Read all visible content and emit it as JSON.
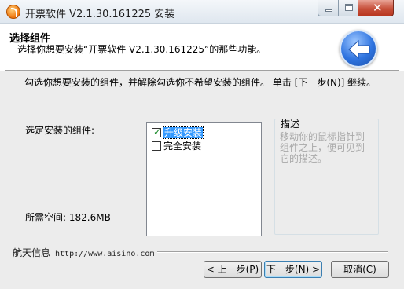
{
  "window": {
    "title": "开票软件 V2.1.30.161225 安装"
  },
  "header": {
    "title": "选择组件",
    "subtitle": "选择你想要安装“开票软件 V2.1.30.161225”的那些功能。"
  },
  "body": {
    "instruction": "勾选你想要安装的组件，并解除勾选你不希望安装的组件。 单击 [下一步(N)] 继续。",
    "select_label": "选定安装的组件:",
    "space_label": "所需空间: 182.6MB",
    "components": [
      {
        "label": "升级安装",
        "checked": true,
        "selected": true
      },
      {
        "label": "完全安装",
        "checked": false,
        "selected": false
      }
    ],
    "description": {
      "title": "描述",
      "text": "移动你的鼠标指针到组件之上，便可见到它的描述。"
    }
  },
  "footer": {
    "brand": "航天信息",
    "url": "http://www.aisino.com",
    "prev_label": "< 上一步(P)",
    "next_label": "下一步(N) >",
    "cancel_label": "取消(C)"
  },
  "icons": {
    "app": "app-icon",
    "back": "back-arrow-icon"
  },
  "colors": {
    "selection": "#3399ff",
    "back_icon": "#2f74e0"
  }
}
